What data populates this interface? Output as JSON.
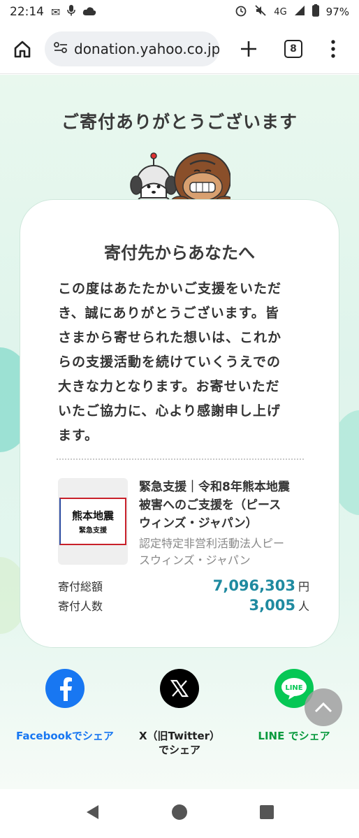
{
  "status_bar": {
    "time": "22:14",
    "network": "4G",
    "battery": "97%"
  },
  "browser": {
    "url": "donation.yahoo.co.jp",
    "tab_count": "8"
  },
  "page": {
    "heading": "ご寄付ありがとうございます",
    "card": {
      "title": "寄付先からあなたへ",
      "message_lines": [
        "この度はあたたかいご支援をいただ",
        "き、誠にありがとうございます。皆",
        "さまから寄せられた想いは、これか",
        "らの支援活動を続けていくうえでの",
        "大きな力となります。お寄せいただ",
        "いたご協力に、心より感謝申し上げ",
        "ます。"
      ],
      "project": {
        "image_line1": "熊本地震",
        "image_line2": "緊急支援",
        "title_lines": [
          "緊急支援｜令和8年熊本地震",
          "被害へのご支援を（ピース",
          "ウィンズ・ジャパン）"
        ],
        "org_lines": [
          "認定特定非営利活動法人ピー",
          "スウィンズ・ジャパン"
        ]
      },
      "stats": {
        "total_label": "寄付総額",
        "total_value": "7,096,303",
        "total_unit": "円",
        "count_label": "寄付人数",
        "count_value": "3,005",
        "count_unit": "人"
      }
    },
    "share": {
      "facebook": {
        "label": "Facebookでシェア",
        "color": "#1877f2"
      },
      "x": {
        "label_line1": "X（旧Twitter）",
        "label_line2": "でシェア",
        "color": "#000000"
      },
      "line": {
        "label": "LINE でシェア",
        "icon_text": "LINE",
        "color": "#06c755"
      }
    }
  },
  "colors": {
    "accent": "#1f8aa0",
    "card_border": "#cfe8dc"
  }
}
